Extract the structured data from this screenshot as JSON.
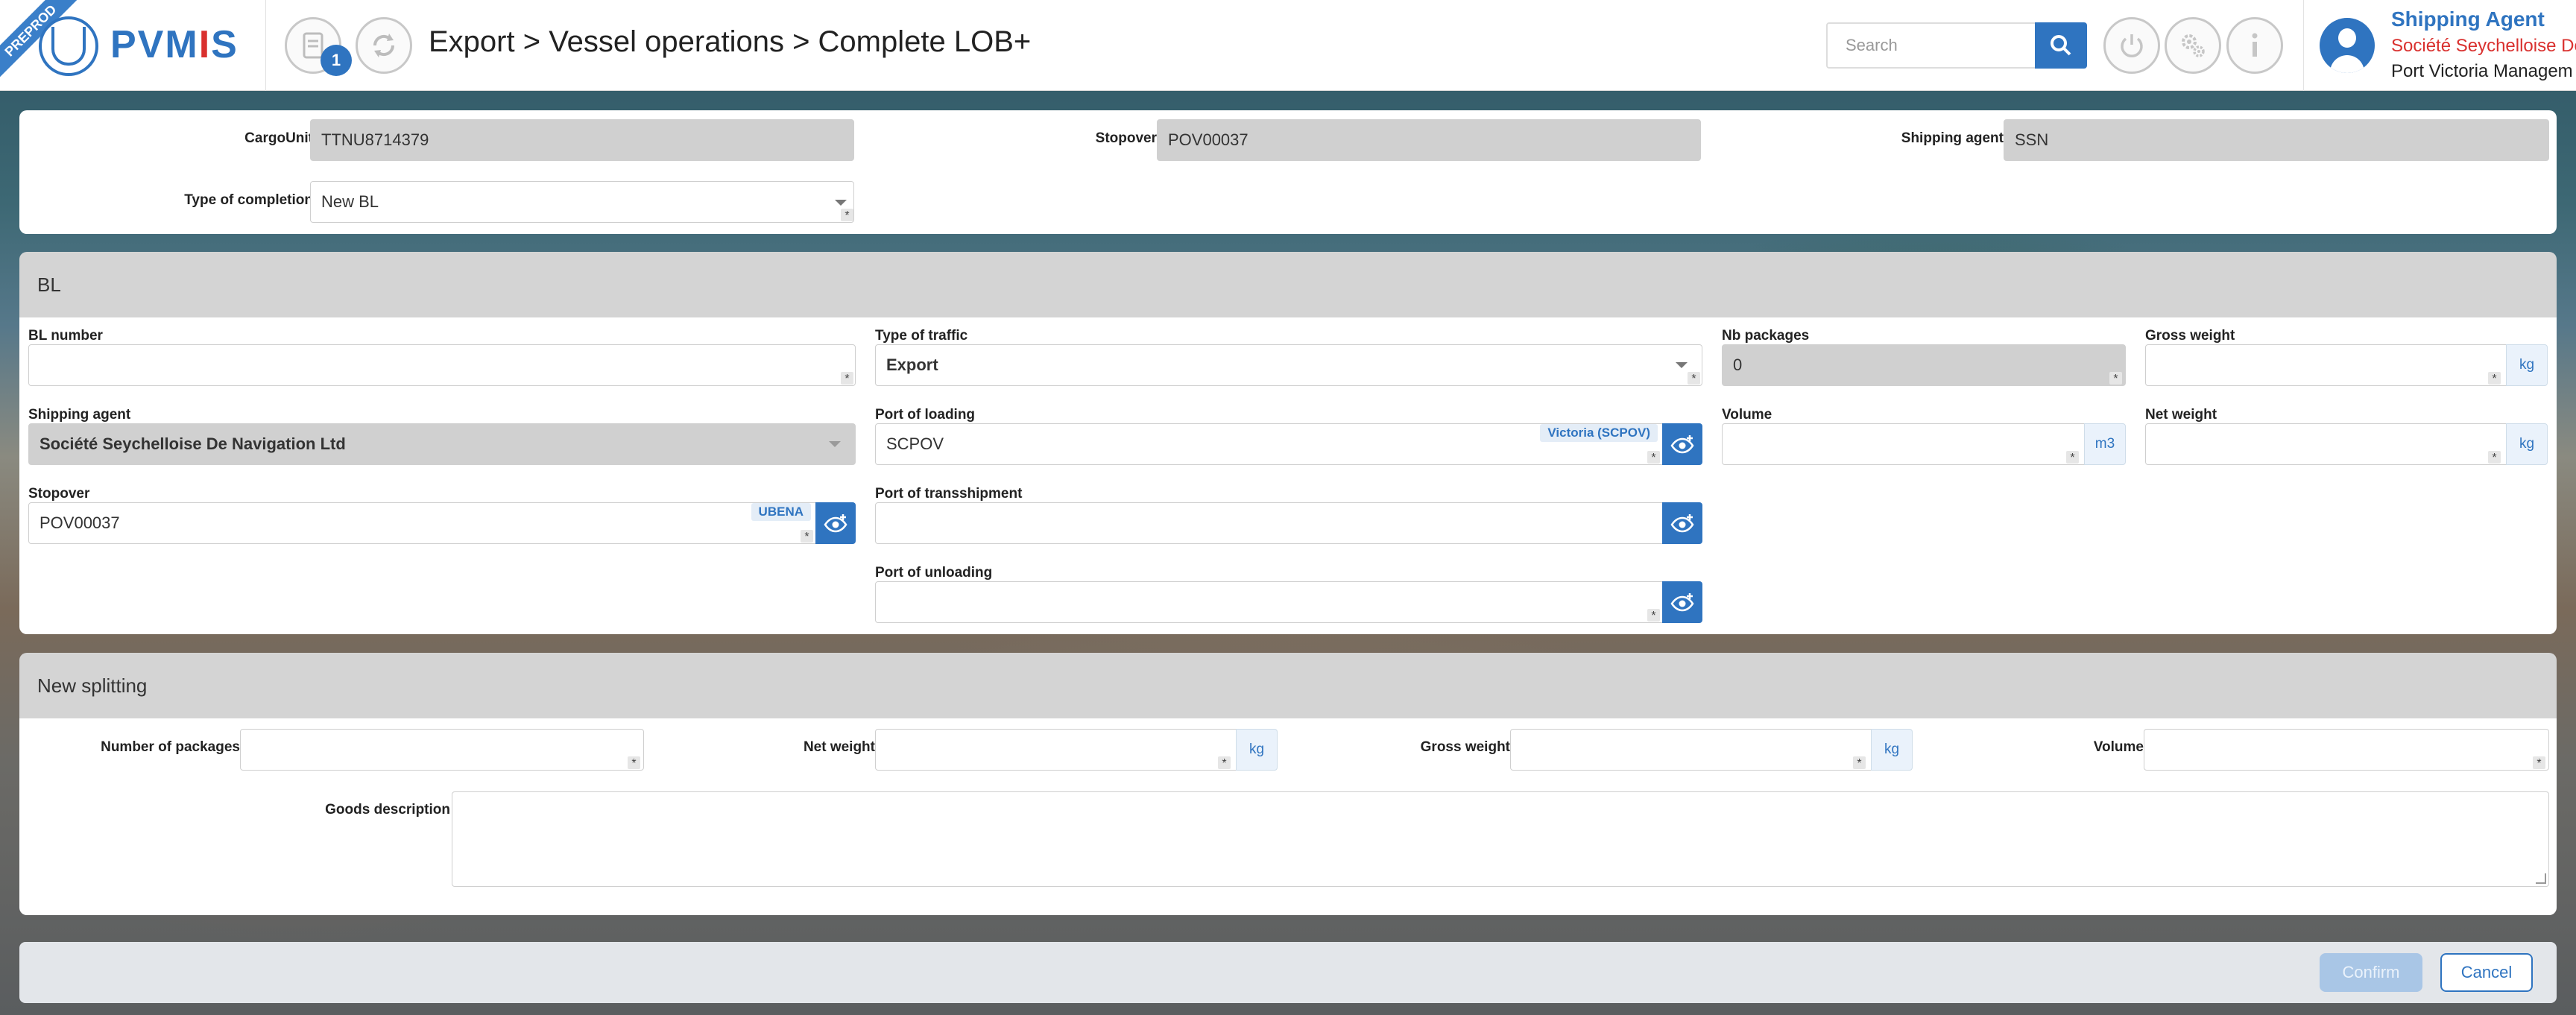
{
  "header": {
    "env_ribbon": "PREPROD",
    "logo_text_pre": "PVM",
    "logo_text_i": "I",
    "logo_text_post": "S",
    "notification_count": "1",
    "page_title": "Export > Vessel operations > Complete LOB+",
    "search_placeholder": "Search",
    "user": {
      "role": "Shipping Agent",
      "company": "Société Seychelloise De",
      "organization": "Port Victoria Managem"
    }
  },
  "top_form": {
    "cargo_unit_label": "CargoUnit",
    "cargo_unit_value": "TTNU8714379",
    "stopover_label": "Stopover",
    "stopover_value": "POV00037",
    "shipping_agent_label": "Shipping agent",
    "shipping_agent_value": "SSN",
    "type_of_completion_label": "Type of completion",
    "type_of_completion_value": "New BL"
  },
  "bl_section": {
    "title": "BL",
    "bl_number_label": "BL number",
    "bl_number_value": "",
    "type_of_traffic_label": "Type of traffic",
    "type_of_traffic_value": "Export",
    "nb_packages_label": "Nb packages",
    "nb_packages_value": "0",
    "gross_weight_label": "Gross weight",
    "gross_weight_unit": "kg",
    "shipping_agent_label": "Shipping agent",
    "shipping_agent_value": "Société Seychelloise De Navigation Ltd",
    "port_of_loading_label": "Port of loading",
    "port_of_loading_value": "SCPOV",
    "port_of_loading_tag": "Victoria (SCPOV)",
    "volume_label": "Volume",
    "volume_unit": "m3",
    "net_weight_label": "Net weight",
    "net_weight_unit": "kg",
    "stopover_label": "Stopover",
    "stopover_value": "POV00037",
    "stopover_tag": "UBENA",
    "port_of_transshipment_label": "Port of transshipment",
    "port_of_unloading_label": "Port of unloading"
  },
  "splitting_section": {
    "title": "New splitting",
    "number_of_packages_label": "Number of packages",
    "net_weight_label": "Net weight",
    "net_weight_unit": "kg",
    "gross_weight_label": "Gross weight",
    "gross_weight_unit": "kg",
    "volume_label": "Volume",
    "goods_description_label": "Goods description"
  },
  "footer": {
    "confirm_label": "Confirm",
    "cancel_label": "Cancel"
  },
  "required_mark": "*",
  "colors": {
    "accent": "#2f74c0",
    "brand_red": "#d9302e",
    "readonly_bg": "#d0d0d0",
    "section_header_bg": "#d4d4d4"
  },
  "icons": {
    "document": "document-icon",
    "refresh": "refresh-icon",
    "search": "search-icon",
    "power": "power-icon",
    "settings": "gears-icon",
    "info": "info-icon",
    "user": "user-avatar-icon",
    "eye_add": "eye-plus-icon"
  }
}
